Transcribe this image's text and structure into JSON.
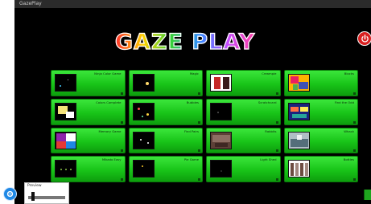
{
  "window": {
    "title": "GazePlay"
  },
  "logo": {
    "text": "GAZE PLAY"
  },
  "colors": {
    "card_green": "#22cc22",
    "background": "#000000",
    "power_red": "#d81f1f",
    "settings_blue": "#1e88e5"
  },
  "games": [
    {
      "title": "Ninja Color Game",
      "thumb": "stars"
    },
    {
      "title": "Magic",
      "thumb": "lamp"
    },
    {
      "title": "Creampie",
      "thumb": "cake"
    },
    {
      "title": "Blocks",
      "thumb": "colorful"
    },
    {
      "title": "Colors Complete",
      "thumb": "paint"
    },
    {
      "title": "Bubbles",
      "thumb": "dots"
    },
    {
      "title": "Scratchcard",
      "thumb": "dark"
    },
    {
      "title": "Find the Odd",
      "thumb": "cars"
    },
    {
      "title": "Memory Game",
      "thumb": "tiles"
    },
    {
      "title": "Find Pairs",
      "thumb": "spark"
    },
    {
      "title": "Rabbits",
      "thumb": "scene"
    },
    {
      "title": "Whack",
      "thumb": "room"
    },
    {
      "title": "Mikado Easy",
      "thumb": "dots2"
    },
    {
      "title": "Pie Game",
      "thumb": "spark2"
    },
    {
      "title": "Light Shed",
      "thumb": "dark2"
    },
    {
      "title": "Bottles",
      "thumb": "bottles"
    }
  ],
  "preview_panel": {
    "label": "Preview"
  }
}
